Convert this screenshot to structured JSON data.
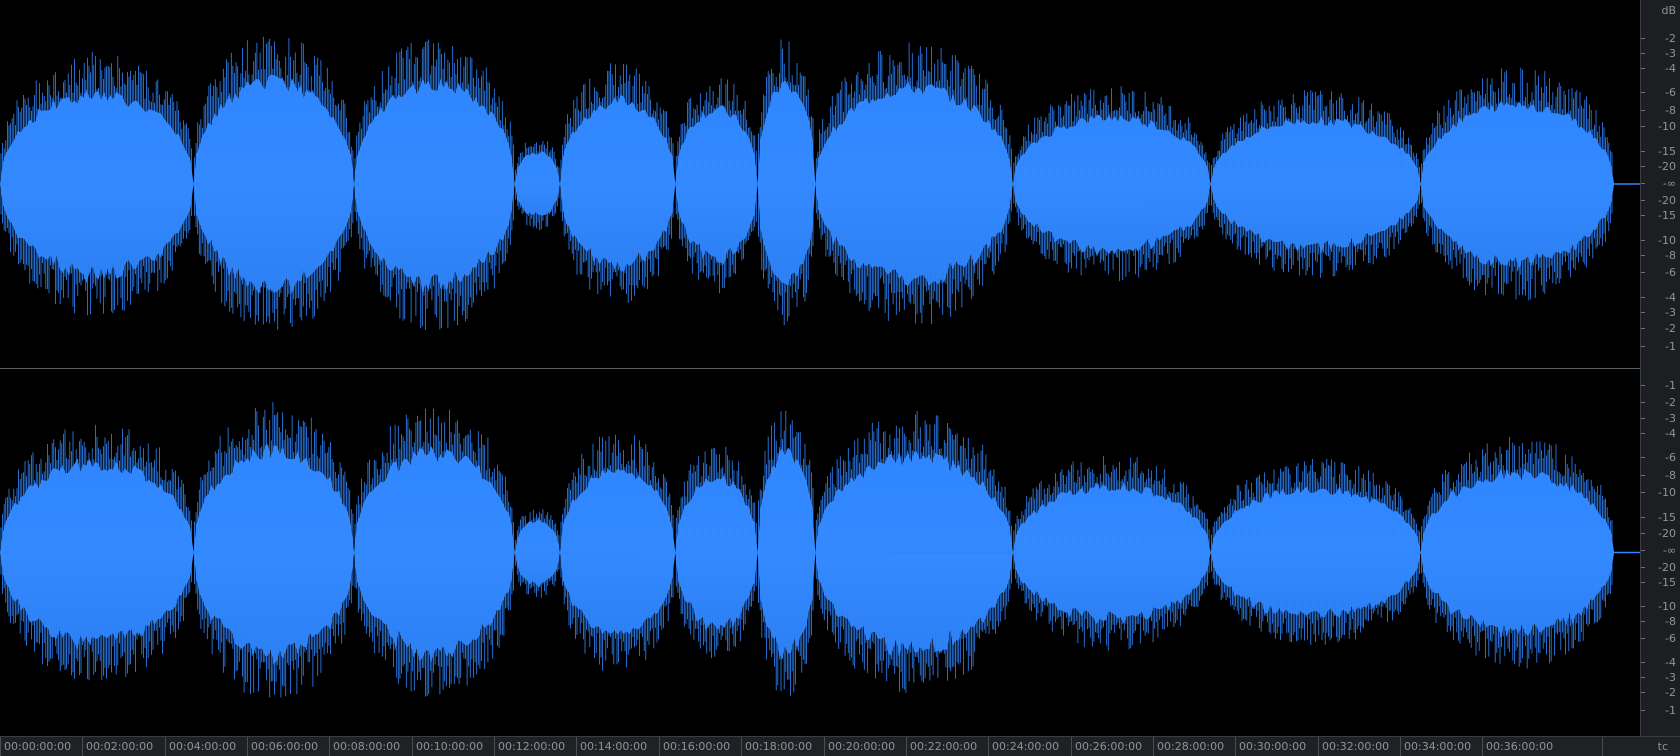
{
  "colors": {
    "waveform": "#2f86ff",
    "background": "#000000",
    "ruler_background": "#1c1e21",
    "ruler_text": "#8d939a"
  },
  "db_ruler": {
    "unit": "dB",
    "top_channel_labels": [
      "-2",
      "-3",
      "-4",
      "-6",
      "-8",
      "-10",
      "-15",
      "-20",
      "-∞",
      "-20",
      "-15",
      "-10",
      "-8",
      "-6",
      "-4",
      "-3",
      "-2",
      "-1"
    ],
    "bottom_channel_labels": [
      "-1",
      "-2",
      "-3",
      "-4",
      "-6",
      "-8",
      "-10",
      "-15",
      "-20",
      "-∞",
      "-20",
      "-15",
      "-10",
      "-8",
      "-6",
      "-4",
      "-3",
      "-2",
      "-1"
    ]
  },
  "time_ruler": {
    "unit": "tc",
    "labels": [
      "00:00:00:00",
      "00:02:00:00",
      "00:04:00:00",
      "00:06:00:00",
      "00:08:00:00",
      "00:10:00:00",
      "00:12:00:00",
      "00:14:00:00",
      "00:16:00:00",
      "00:18:00:00",
      "00:20:00:00",
      "00:22:00:00",
      "00:24:00:00",
      "00:26:00:00",
      "00:28:00:00",
      "00:30:00:00",
      "00:32:00:00",
      "00:34:00:00",
      "00:36:00:00"
    ]
  },
  "waveform_segments": [
    {
      "start": 0.0,
      "end": 4.7,
      "level": 0.7,
      "dip": 0.45
    },
    {
      "start": 4.7,
      "end": 8.6,
      "level": 0.8,
      "dip": 0.4
    },
    {
      "start": 8.6,
      "end": 12.5,
      "level": 0.78,
      "dip": 0.45
    },
    {
      "start": 12.5,
      "end": 13.6,
      "level": 0.25,
      "dip": 0.2
    },
    {
      "start": 13.6,
      "end": 16.4,
      "level": 0.65,
      "dip": 0.45
    },
    {
      "start": 16.4,
      "end": 18.4,
      "level": 0.58,
      "dip": 0.5
    },
    {
      "start": 18.4,
      "end": 19.8,
      "level": 0.78,
      "dip": 0.5
    },
    {
      "start": 19.8,
      "end": 24.6,
      "level": 0.75,
      "dip": 0.35
    },
    {
      "start": 24.6,
      "end": 29.4,
      "level": 0.52,
      "dip": 0.3
    },
    {
      "start": 29.4,
      "end": 34.5,
      "level": 0.5,
      "dip": 0.35
    },
    {
      "start": 34.5,
      "end": 39.2,
      "level": 0.62,
      "dip": 0.25
    }
  ],
  "timeline_total_minutes": 39.2
}
